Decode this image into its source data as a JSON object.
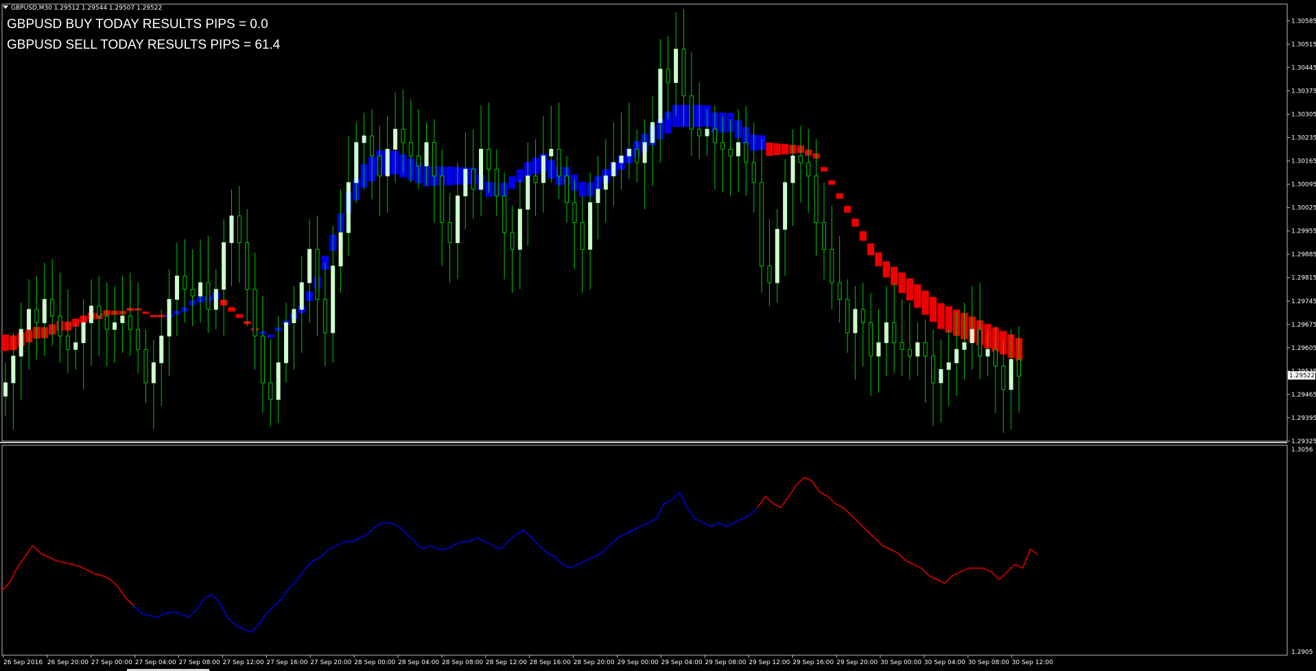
{
  "window": {
    "symbol_info": "GBPUSD,M30  1.29512 1.29544 1.29507 1.29522"
  },
  "overlay": {
    "buy_text": "GBPUSD BUY TODAY RESULTS PIPS = 0.0",
    "sell_text": "GBPUSD SELL TODAY RESULTS PIPS = 61.4"
  },
  "colors": {
    "background": "#000000",
    "bull_body": "#ccffcc",
    "wick": "#00cc00",
    "ribbon_up": "#0000ee",
    "ribbon_down": "#ee0000",
    "axis": "#c0c0c0"
  },
  "price_axis": {
    "labels": [
      "1.30585",
      "1.30515",
      "1.30445",
      "1.30375",
      "1.30305",
      "1.30235",
      "1.30165",
      "1.30095",
      "1.30025",
      "1.29955",
      "1.29885",
      "1.29815",
      "1.29745",
      "1.29675",
      "1.29605",
      "1.29535",
      "1.29465",
      "1.29395",
      "1.29325"
    ],
    "current_price": "1.29522"
  },
  "indicator_axis": {
    "top_label": "1.3056",
    "bottom_label": "1.2905"
  },
  "time_axis": {
    "labels": [
      "26 Sep 2016",
      "26 Sep 20:00",
      "27 Sep 00:00",
      "27 Sep 04:00",
      "27 Sep 08:00",
      "27 Sep 12:00",
      "27 Sep 16:00",
      "27 Sep 20:00",
      "28 Sep 00:00",
      "28 Sep 04:00",
      "28 Sep 08:00",
      "28 Sep 12:00",
      "28 Sep 16:00",
      "28 Sep 20:00",
      "29 Sep 00:00",
      "29 Sep 04:00",
      "29 Sep 08:00",
      "29 Sep 12:00",
      "29 Sep 16:00",
      "29 Sep 20:00",
      "30 Sep 00:00",
      "30 Sep 04:00",
      "30 Sep 08:00",
      "30 Sep 12:00"
    ]
  },
  "chart_data": {
    "type": "candlestick",
    "ylim": [
      1.29325,
      1.30635
    ],
    "candles_close": [
      1.295,
      1.2958,
      1.2966,
      1.2972,
      1.2968,
      1.2975,
      1.297,
      1.2964,
      1.296,
      1.2962,
      1.2968,
      1.2973,
      1.297,
      1.2966,
      1.2968,
      1.297,
      1.2966,
      1.296,
      1.295,
      1.2956,
      1.2964,
      1.2975,
      1.2982,
      1.2978,
      1.2976,
      1.298,
      1.2972,
      1.2978,
      1.2992,
      1.3,
      1.2992,
      1.2978,
      1.2964,
      1.295,
      1.2945,
      1.2956,
      1.2968,
      1.2972,
      1.298,
      1.299,
      1.2975,
      1.2965,
      1.2985,
      1.2995,
      1.301,
      1.3022,
      1.3024,
      1.3018,
      1.3012,
      1.302,
      1.3026,
      1.3022,
      1.3018,
      1.3015,
      1.3022,
      1.3012,
      1.2998,
      1.2992,
      1.3006,
      1.3014,
      1.3008,
      1.302,
      1.3014,
      1.3006,
      1.2995,
      1.299,
      1.3002,
      1.3012,
      1.301,
      1.3018,
      1.302,
      1.3012,
      1.3004,
      1.2998,
      1.299,
      1.3004,
      1.3008,
      1.3012,
      1.3016,
      1.3018,
      1.302,
      1.3016,
      1.3022,
      1.3028,
      1.3044,
      1.304,
      1.305,
      1.3036,
      1.3026,
      1.3024,
      1.3026,
      1.3022,
      1.302,
      1.3018,
      1.3022,
      1.3016,
      1.301,
      1.2985,
      1.298,
      1.2996,
      1.301,
      1.3018,
      1.3016,
      1.3012,
      1.2998,
      1.299,
      1.298,
      1.2975,
      1.2965,
      1.2972,
      1.2968,
      1.2958,
      1.2962,
      1.2968,
      1.2962,
      1.296,
      1.2958,
      1.2962,
      1.2958,
      1.295,
      1.2954,
      1.2956,
      1.296,
      1.2962,
      1.2966,
      1.2958,
      1.296,
      1.2955,
      1.2948,
      1.2957,
      1.2952
    ],
    "ribbon_mid": [
      1.2962,
      1.2962,
      1.2963,
      1.2964,
      1.2965,
      1.2965,
      1.2966,
      1.2967,
      1.2967,
      1.2968,
      1.2969,
      1.297,
      1.297,
      1.2971,
      1.2971,
      1.2971,
      1.2972,
      1.2972,
      1.2971,
      1.297,
      1.297,
      1.297,
      1.2971,
      1.2972,
      1.2974,
      1.2975,
      1.2975,
      1.2976,
      1.2974,
      1.2972,
      1.297,
      1.2968,
      1.2966,
      1.2965,
      1.2964,
      1.2966,
      1.2968,
      1.297,
      1.2972,
      1.2976,
      1.298,
      1.2986,
      1.2992,
      1.2998,
      1.3004,
      1.3008,
      1.3012,
      1.3014,
      1.3016,
      1.3016,
      1.3016,
      1.3015,
      1.3014,
      1.3013,
      1.3012,
      1.3012,
      1.3012,
      1.3012,
      1.3012,
      1.3012,
      1.3012,
      1.301,
      1.3008,
      1.3008,
      1.3008,
      1.301,
      1.3012,
      1.3014,
      1.3015,
      1.3016,
      1.3014,
      1.3012,
      1.3012,
      1.301,
      1.3008,
      1.3008,
      1.301,
      1.3012,
      1.3014,
      1.3016,
      1.3018,
      1.302,
      1.3022,
      1.3024,
      1.3026,
      1.3028,
      1.303,
      1.303,
      1.303,
      1.303,
      1.303,
      1.3028,
      1.3028,
      1.3028,
      1.3026,
      1.3024,
      1.3022,
      1.3022,
      1.302,
      1.302,
      1.302,
      1.302,
      1.302,
      1.3019,
      1.3018,
      1.3014,
      1.301,
      1.3006,
      1.3002,
      1.2998,
      1.2994,
      1.299,
      1.2987,
      1.2984,
      1.2982,
      1.298,
      1.2978,
      1.2976,
      1.2974,
      1.2972,
      1.297,
      1.2969,
      1.2968,
      1.2967,
      1.2966,
      1.2965,
      1.2964,
      1.2963,
      1.2962,
      1.2961,
      1.296
    ],
    "ribbon_width": [
      22,
      20,
      18,
      17,
      16,
      15,
      14,
      13,
      12,
      11,
      10,
      9,
      8,
      7,
      6,
      5,
      4,
      3,
      3,
      3,
      3,
      4,
      5,
      6,
      7,
      8,
      9,
      9,
      8,
      6,
      5,
      4,
      4,
      4,
      4,
      5,
      6,
      8,
      10,
      13,
      16,
      19,
      22,
      25,
      28,
      30,
      32,
      33,
      33,
      33,
      32,
      31,
      30,
      29,
      28,
      27,
      26,
      25,
      24,
      23,
      22,
      21,
      20,
      19,
      18,
      17,
      18,
      20,
      22,
      24,
      25,
      25,
      24,
      22,
      20,
      19,
      18,
      18,
      18,
      19,
      20,
      22,
      24,
      26,
      28,
      30,
      30,
      30,
      30,
      30,
      29,
      28,
      27,
      26,
      25,
      24,
      22,
      20,
      18,
      16,
      14,
      12,
      10,
      8,
      7,
      6,
      6,
      7,
      9,
      11,
      13,
      16,
      19,
      22,
      25,
      28,
      30,
      32,
      33,
      34,
      35,
      36,
      36,
      36,
      35,
      34,
      33,
      33,
      32,
      32,
      31,
      31
    ],
    "ribbon_color": [
      "down",
      "down",
      "down",
      "down",
      "down",
      "down",
      "down",
      "down",
      "down",
      "down",
      "down",
      "down",
      "down",
      "down",
      "down",
      "down",
      "down",
      "down",
      "down",
      "down",
      "down",
      "up",
      "up",
      "up",
      "up",
      "up",
      "up",
      "up",
      "down",
      "down",
      "down",
      "down",
      "down",
      "up",
      "up",
      "up",
      "up",
      "up",
      "up",
      "up",
      "up",
      "up",
      "up",
      "up",
      "up",
      "up",
      "up",
      "up",
      "up",
      "up",
      "up",
      "up",
      "up",
      "up",
      "up",
      "up",
      "up",
      "up",
      "up",
      "up",
      "up",
      "up",
      "up",
      "up",
      "up",
      "up",
      "up",
      "up",
      "up",
      "up",
      "up",
      "up",
      "up",
      "up",
      "up",
      "up",
      "up",
      "up",
      "up",
      "up",
      "up",
      "up",
      "up",
      "up",
      "up",
      "up",
      "up",
      "up",
      "up",
      "up",
      "up",
      "up",
      "up",
      "up",
      "up",
      "up",
      "up",
      "up",
      "down",
      "down",
      "down",
      "down",
      "down",
      "down",
      "down",
      "down",
      "down",
      "down",
      "down",
      "down",
      "down",
      "down",
      "down",
      "down",
      "down",
      "down",
      "down",
      "down",
      "down",
      "down",
      "down",
      "down",
      "down",
      "down",
      "down",
      "down",
      "down",
      "down",
      "down",
      "down",
      "down",
      "down"
    ],
    "indicator_line": [
      0.74,
      0.7,
      0.62,
      0.56,
      0.5,
      0.54,
      0.56,
      0.58,
      0.59,
      0.6,
      0.61,
      0.63,
      0.65,
      0.66,
      0.68,
      0.72,
      0.78,
      0.82,
      0.86,
      0.87,
      0.88,
      0.86,
      0.85,
      0.86,
      0.88,
      0.84,
      0.78,
      0.76,
      0.8,
      0.88,
      0.92,
      0.94,
      0.96,
      0.92,
      0.86,
      0.82,
      0.78,
      0.72,
      0.68,
      0.62,
      0.58,
      0.56,
      0.52,
      0.5,
      0.48,
      0.48,
      0.46,
      0.44,
      0.4,
      0.38,
      0.38,
      0.4,
      0.44,
      0.48,
      0.52,
      0.5,
      0.52,
      0.52,
      0.5,
      0.48,
      0.48,
      0.46,
      0.48,
      0.5,
      0.52,
      0.48,
      0.44,
      0.42,
      0.46,
      0.5,
      0.54,
      0.56,
      0.6,
      0.62,
      0.6,
      0.58,
      0.56,
      0.54,
      0.5,
      0.46,
      0.44,
      0.42,
      0.4,
      0.38,
      0.36,
      0.28,
      0.26,
      0.22,
      0.3,
      0.36,
      0.38,
      0.4,
      0.38,
      0.4,
      0.38,
      0.36,
      0.34,
      0.3,
      0.24,
      0.28,
      0.3,
      0.24,
      0.18,
      0.14,
      0.16,
      0.22,
      0.24,
      0.28,
      0.3,
      0.34,
      0.38,
      0.42,
      0.46,
      0.5,
      0.52,
      0.54,
      0.58,
      0.6,
      0.62,
      0.66,
      0.68,
      0.7,
      0.66,
      0.64,
      0.62,
      0.62,
      0.62,
      0.64,
      0.68,
      0.64,
      0.6,
      0.62,
      0.52,
      0.55
    ],
    "indicator_color": [
      "down",
      "down",
      "down",
      "down",
      "down",
      "down",
      "down",
      "down",
      "down",
      "down",
      "down",
      "down",
      "down",
      "down",
      "down",
      "down",
      "down",
      "down",
      "up",
      "up",
      "up",
      "up",
      "up",
      "up",
      "up",
      "up",
      "up",
      "up",
      "up",
      "up",
      "up",
      "up",
      "up",
      "up",
      "up",
      "up",
      "up",
      "up",
      "up",
      "up",
      "up",
      "up",
      "up",
      "up",
      "up",
      "up",
      "up",
      "up",
      "up",
      "up",
      "up",
      "up",
      "up",
      "up",
      "up",
      "up",
      "up",
      "up",
      "up",
      "up",
      "up",
      "up",
      "up",
      "up",
      "up",
      "up",
      "up",
      "up",
      "up",
      "up",
      "up",
      "up",
      "up",
      "up",
      "up",
      "up",
      "up",
      "up",
      "up",
      "up",
      "up",
      "up",
      "up",
      "up",
      "up",
      "up",
      "up",
      "up",
      "up",
      "up",
      "up",
      "up",
      "up",
      "up",
      "up",
      "up",
      "up",
      "up",
      "down",
      "down",
      "down",
      "down",
      "down",
      "down",
      "down",
      "down",
      "down",
      "down",
      "down",
      "down",
      "down",
      "down",
      "down",
      "down",
      "down",
      "down",
      "down",
      "down",
      "down",
      "down",
      "down",
      "down",
      "down",
      "down",
      "down",
      "down",
      "down",
      "down",
      "down",
      "down",
      "down",
      "down"
    ]
  }
}
